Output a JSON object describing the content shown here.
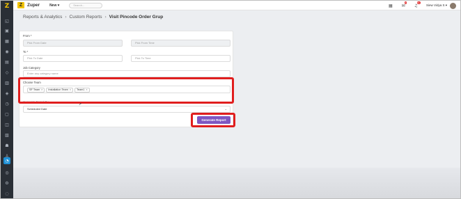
{
  "app": {
    "brand": "Zuper",
    "new_label": "New ▾",
    "search_placeholder": "Search...",
    "user_name": "Siew Vidya S ▾",
    "notification_badge_1": "4",
    "notification_badge_2": "9+"
  },
  "breadcrumb": {
    "item1": "Reports & Analytics",
    "item2": "Custom Reports",
    "current": "Visit Pincode Order Grup"
  },
  "form": {
    "from_label": "From *",
    "from_date_placeholder": "Pick From Date",
    "from_time_placeholder": "Pick From Time",
    "to_label": "To *",
    "to_date_placeholder": "Pick To Date",
    "to_time_placeholder": "Pick To Time",
    "job_category_label": "Job Category",
    "job_category_placeholder": "Enter any category name",
    "choose_team_label": "Choose Team",
    "teams": [
      "SF Team",
      "Installation Team",
      "Team1"
    ],
    "filter_label": "Generate Based By",
    "filter_value": "Scheduled Date",
    "generate_button": "Generate Report"
  },
  "colors": {
    "accent": "#7e57c2",
    "highlight": "#e01e1e",
    "sidebar": "#2a2f36",
    "active_item": "#1e90d6"
  }
}
